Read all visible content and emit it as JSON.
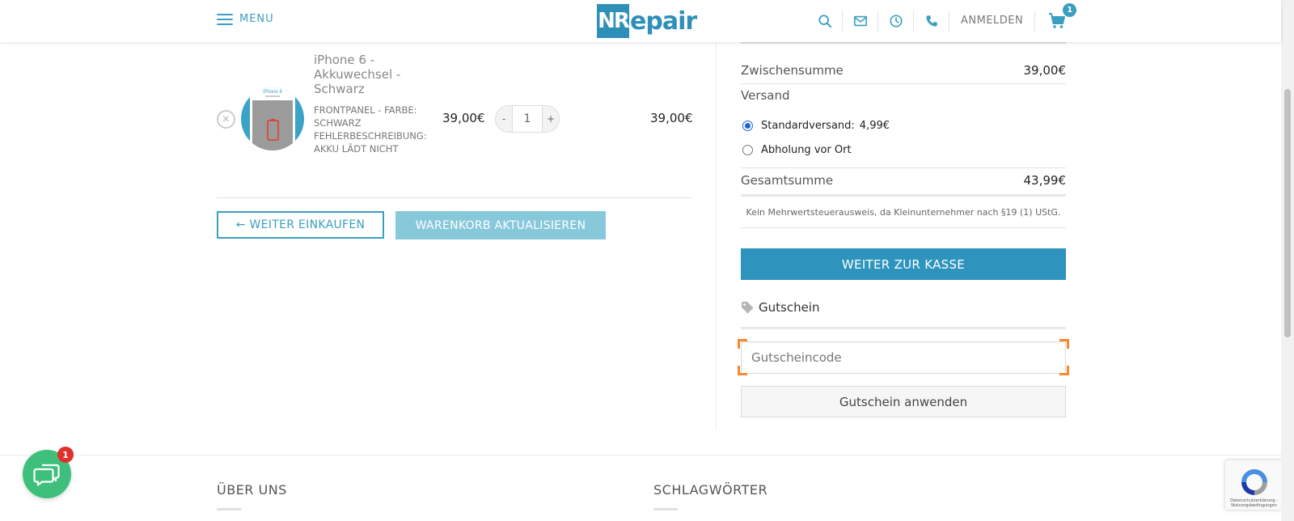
{
  "header": {
    "menu_label": "MENU",
    "logo_box": "NR",
    "logo_text": "epair",
    "login_label": "ANMELDEN",
    "cart_count": "1",
    "icons": [
      "search-icon",
      "mail-icon",
      "clock-icon",
      "phone-icon",
      "cart-icon"
    ]
  },
  "cart": {
    "item": {
      "name": "iPhone 6 - Akkuwechsel - Schwarz",
      "meta_line1": "FRONTPANEL - FARBE:",
      "meta_line2": "SCHWARZ",
      "meta_line3": "FEHLERBESCHREIBUNG:",
      "meta_line4": "AKKU LÄDT NICHT",
      "price": "39,00€",
      "quantity": "1",
      "qty_minus": "-",
      "qty_plus": "+",
      "subtotal": "39,00€",
      "remove_symbol": "×",
      "thumb_label": "iPhone 6"
    },
    "continue_label": "← WEITER EINKAUFEN",
    "update_label": "WARENKORB AKTUALISIEREN"
  },
  "totals": {
    "subtotal_label": "Zwischensumme",
    "subtotal_value": "39,00€",
    "shipping_label": "Versand",
    "shipping_options": [
      {
        "label": "Standardversand:",
        "price": "4,99€",
        "checked": true
      },
      {
        "label": "Abholung vor Ort",
        "price": "",
        "checked": false
      }
    ],
    "total_label": "Gesamtsumme",
    "total_value": "43,99€",
    "tax_note": "Kein Mehrwertsteuerausweis, da Kleinunternehmer nach §19 (1) UStG.",
    "checkout_label": "WEITER ZUR KASSE"
  },
  "coupon": {
    "heading": "Gutschein",
    "placeholder": "Gutscheincode",
    "apply_label": "Gutschein anwenden"
  },
  "footer": {
    "col1_heading": "ÜBER UNS",
    "col2_heading": "SCHLAGWÖRTER"
  },
  "chat": {
    "badge": "1"
  },
  "recaptcha": {
    "text": "Datenschutzerklärung - Nutzungsbedingungen"
  },
  "colors": {
    "accent": "#3a9fc0",
    "checkout": "#2e94bd",
    "update_button": "#88c8db",
    "chat": "#3ec07c",
    "badge_red": "#e0302a",
    "focus_corners": "#f58a32"
  }
}
